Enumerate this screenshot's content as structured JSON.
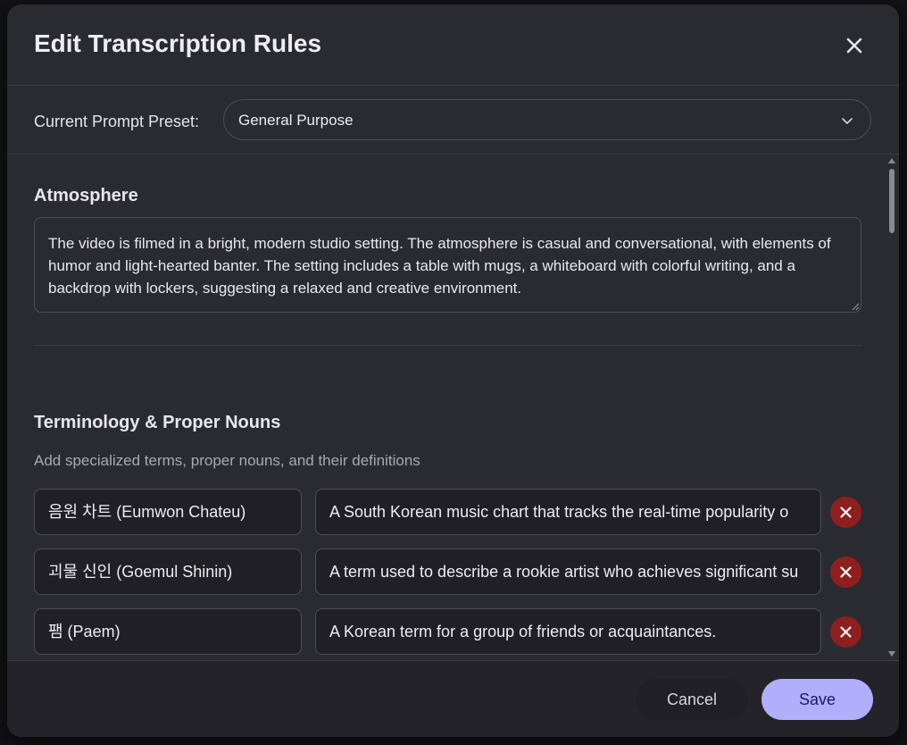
{
  "modal": {
    "title": "Edit Transcription Rules"
  },
  "preset": {
    "label": "Current Prompt Preset:",
    "selected": "General Purpose"
  },
  "atmosphere": {
    "title": "Atmosphere",
    "text": "The video is filmed in a bright, modern studio setting. The atmosphere is casual and conversational, with elements of humor and light-hearted banter. The setting includes a table with mugs, a whiteboard with colorful writing, and a backdrop with lockers, suggesting a relaxed and creative environment."
  },
  "terminology": {
    "title": "Terminology & Proper Nouns",
    "subtitle": "Add specialized terms, proper nouns, and their definitions",
    "items": [
      {
        "term": "음원 차트 (Eumwon Chateu)",
        "definition": "A South Korean music chart that tracks the real-time popularity o"
      },
      {
        "term": "괴물 신인 (Goemul Shinin)",
        "definition": "A term used to describe a rookie artist who achieves significant su"
      },
      {
        "term": "팸 (Paem)",
        "definition": "A Korean term for a group of friends or acquaintances."
      }
    ]
  },
  "footer": {
    "cancel_label": "Cancel",
    "save_label": "Save"
  },
  "colors": {
    "modal_bg": "#2a2a31",
    "field_bg": "#1f1f25",
    "remove_button": "#8e1f1f",
    "save_button": "#b1aefb",
    "save_text": "#1b1a66"
  },
  "icons": {
    "close": "close-icon",
    "preset_dropdown": "chevron-down-icon",
    "remove_term": "close-icon"
  }
}
